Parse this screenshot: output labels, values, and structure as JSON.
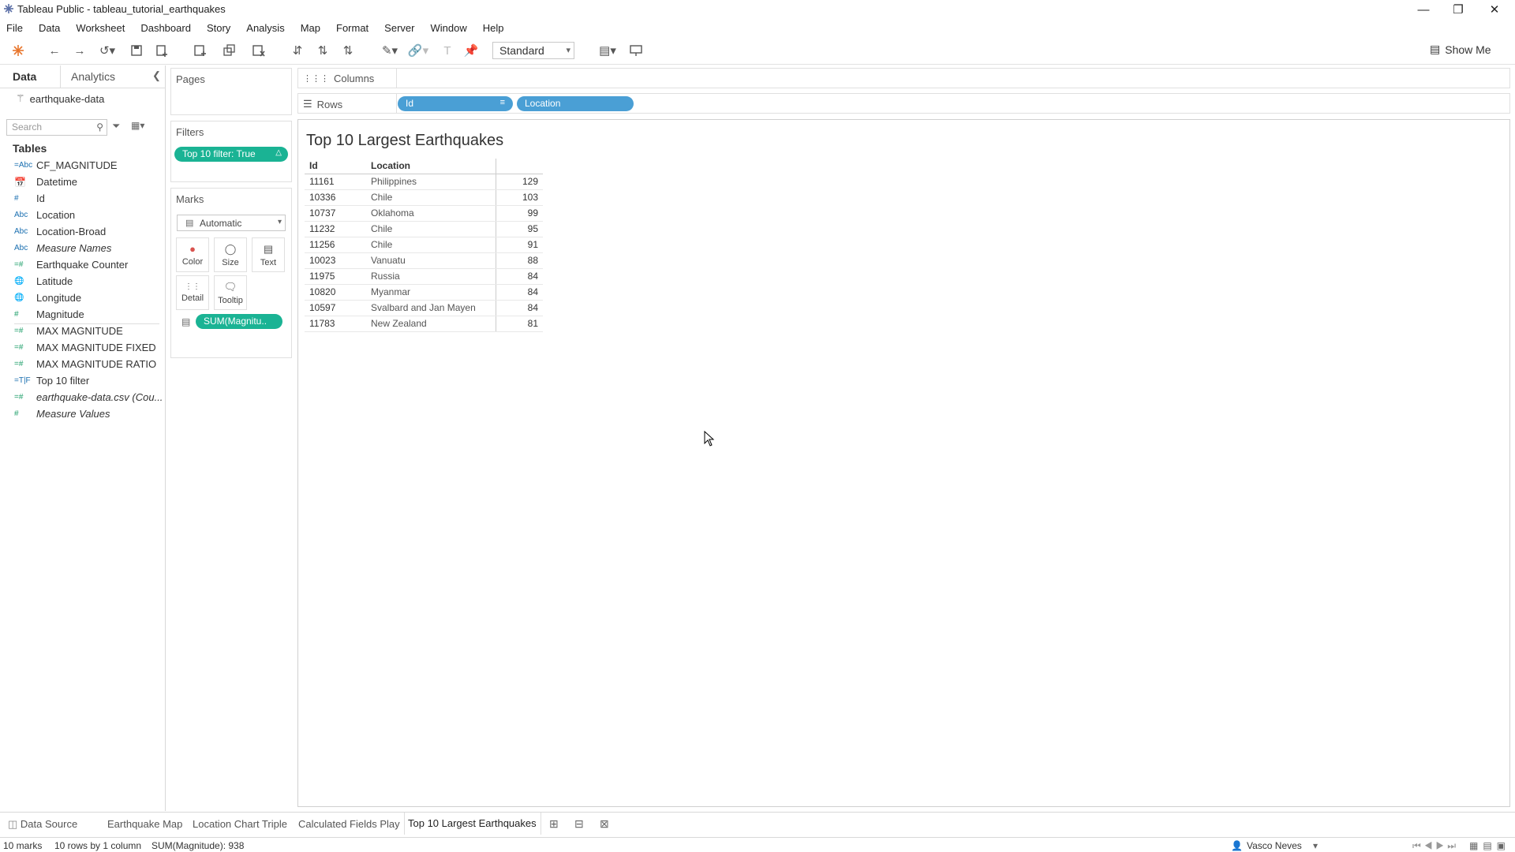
{
  "window": {
    "title": "Tableau Public - tableau_tutorial_earthquakes",
    "controls": [
      "minimize",
      "restore",
      "close"
    ]
  },
  "menu": [
    "File",
    "Data",
    "Worksheet",
    "Dashboard",
    "Story",
    "Analysis",
    "Map",
    "Format",
    "Server",
    "Window",
    "Help"
  ],
  "toolbar": {
    "fit": "Standard",
    "show_me": "Show Me"
  },
  "data_pane": {
    "tabs": [
      "Data",
      "Analytics"
    ],
    "datasource": "earthquake-data",
    "search_placeholder": "Search",
    "tables_heading": "Tables",
    "fields": [
      {
        "icon": "=Abc",
        "label": "CF_MAGNITUDE",
        "type": "dimension"
      },
      {
        "icon": "calendar",
        "label": "Datetime",
        "type": "dimension"
      },
      {
        "icon": "#",
        "label": "Id",
        "type": "dimension"
      },
      {
        "icon": "Abc",
        "label": "Location",
        "type": "dimension"
      },
      {
        "icon": "Abc",
        "label": "Location-Broad",
        "type": "dimension"
      },
      {
        "icon": "Abc",
        "label": "Measure Names",
        "type": "dimension",
        "italic": true
      },
      {
        "icon": "=#",
        "label": "Earthquake Counter",
        "type": "measure"
      },
      {
        "icon": "globe",
        "label": "Latitude",
        "type": "measure"
      },
      {
        "icon": "globe",
        "label": "Longitude",
        "type": "measure"
      },
      {
        "icon": "#",
        "label": "Magnitude",
        "type": "measure"
      },
      {
        "icon": "=#",
        "label": "MAX MAGNITUDE",
        "type": "measure"
      },
      {
        "icon": "=#",
        "label": "MAX MAGNITUDE FIXED",
        "type": "measure"
      },
      {
        "icon": "=#",
        "label": "MAX MAGNITUDE RATIO",
        "type": "measure"
      },
      {
        "icon": "=T|F",
        "label": "Top 10 filter",
        "type": "dimension"
      },
      {
        "icon": "=#",
        "label": "earthquake-data.csv (Cou...",
        "type": "measure",
        "italic": true
      },
      {
        "icon": "#",
        "label": "Measure Values",
        "type": "measure",
        "italic": true
      }
    ]
  },
  "cards": {
    "pages": "Pages",
    "filters": "Filters",
    "filter_pill": "Top 10 filter: True",
    "marks": "Marks",
    "mark_type": "Automatic",
    "mark_buttons": [
      "Color",
      "Size",
      "Text",
      "Detail",
      "Tooltip"
    ],
    "text_pill": "SUM(Magnitu.."
  },
  "shelves": {
    "columns": "Columns",
    "rows": "Rows",
    "row_pills": [
      "Id",
      "Location"
    ]
  },
  "sheet": {
    "title": "Top 10 Largest Earthquakes",
    "headers": [
      "Id",
      "Location"
    ],
    "rows": [
      {
        "id": "11161",
        "location": "Philippines",
        "value": "129"
      },
      {
        "id": "10336",
        "location": "Chile",
        "value": "103"
      },
      {
        "id": "10737",
        "location": "Oklahoma",
        "value": "99"
      },
      {
        "id": "11232",
        "location": "Chile",
        "value": "95"
      },
      {
        "id": "11256",
        "location": "Chile",
        "value": "91"
      },
      {
        "id": "10023",
        "location": "Vanuatu",
        "value": "88"
      },
      {
        "id": "11975",
        "location": "Russia",
        "value": "84"
      },
      {
        "id": "10820",
        "location": "Myanmar",
        "value": "84"
      },
      {
        "id": "10597",
        "location": "Svalbard and Jan Mayen",
        "value": "84"
      },
      {
        "id": "11783",
        "location": "New Zealand",
        "value": "81"
      }
    ]
  },
  "tabs": [
    "Data Source",
    "Earthquake Map",
    "Location Chart Triple",
    "Calculated Fields Play",
    "Top 10 Largest Earthquakes"
  ],
  "status": {
    "marks": "10 marks",
    "dims": "10 rows by 1 column",
    "sum": "SUM(Magnitude): 938",
    "user": "Vasco Neves"
  },
  "colors": {
    "pill_green": "#1ab394",
    "pill_blue": "#4a9fd5"
  }
}
